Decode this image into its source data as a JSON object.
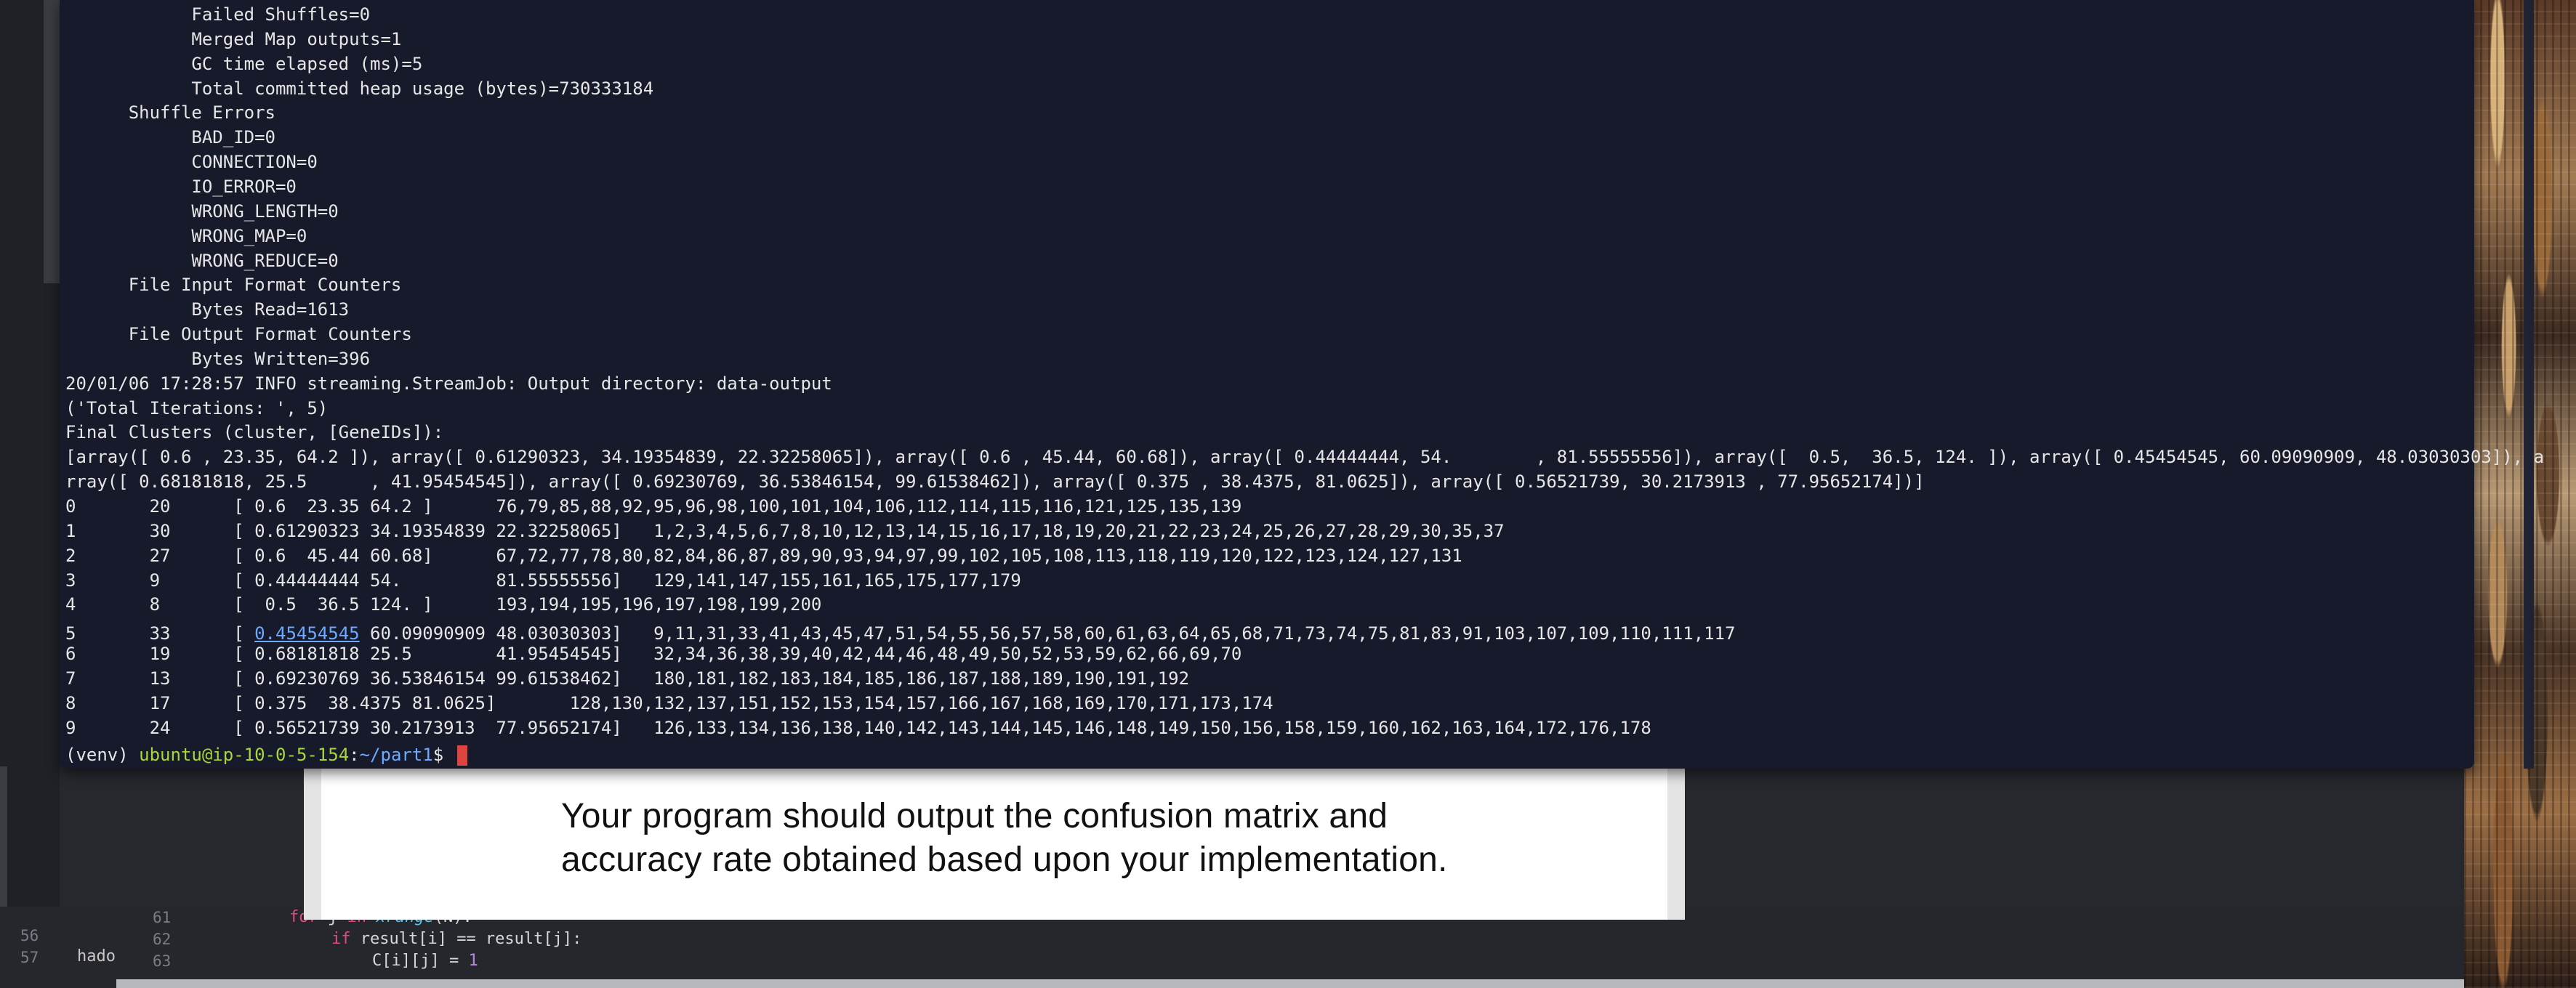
{
  "terminal": {
    "lines": [
      "            Failed Shuffles=0",
      "            Merged Map outputs=1",
      "            GC time elapsed (ms)=5",
      "            Total committed heap usage (bytes)=730333184",
      "      Shuffle Errors",
      "            BAD_ID=0",
      "            CONNECTION=0",
      "            IO_ERROR=0",
      "            WRONG_LENGTH=0",
      "            WRONG_MAP=0",
      "            WRONG_REDUCE=0",
      "      File Input Format Counters",
      "            Bytes Read=1613",
      "      File Output Format Counters",
      "            Bytes Written=396",
      "20/01/06 17:28:57 INFO streaming.StreamJob: Output directory: data-output",
      "('Total Iterations: ', 5)",
      "Final Clusters (cluster, [GeneIDs]):",
      "[array([ 0.6 , 23.35, 64.2 ]), array([ 0.61290323, 34.19354839, 22.32258065]), array([ 0.6 , 45.44, 60.68]), array([ 0.44444444, 54.        , 81.55555556]), array([  0.5,  36.5, 124. ]), array([ 0.45454545, 60.09090909, 48.03030303]), a",
      "rray([ 0.68181818, 25.5      , 41.95454545]), array([ 0.69230769, 36.53846154, 99.61538462]), array([ 0.375 , 38.4375, 81.0625]), array([ 0.56521739, 30.2173913 , 77.95652174])]",
      "0       20      [ 0.6  23.35 64.2 ]      76,79,85,88,92,95,96,98,100,101,104,106,112,114,115,116,121,125,135,139",
      "1       30      [ 0.61290323 34.19354839 22.32258065]   1,2,3,4,5,6,7,8,10,12,13,14,15,16,17,18,19,20,21,22,23,24,25,26,27,28,29,30,35,37",
      "2       27      [ 0.6  45.44 60.68]      67,72,77,78,80,82,84,86,87,89,90,93,94,97,99,102,105,108,113,118,119,120,122,123,124,127,131",
      "3       9       [ 0.44444444 54.         81.55555556]   129,141,147,155,161,165,175,177,179",
      "4       8       [  0.5  36.5 124. ]      193,194,195,196,197,198,199,200"
    ],
    "row5_prefix": "5       33      [ ",
    "row5_link": "0.45454545",
    "row5_suffix": " 60.09090909 48.03030303]   9,11,31,33,41,43,45,47,51,54,55,56,57,58,60,61,63,64,65,68,71,73,74,75,81,83,91,103,107,109,110,111,117",
    "lines_after": [
      "6       19      [ 0.68181818 25.5        41.95454545]   32,34,36,38,39,40,42,44,46,48,49,50,52,53,59,62,66,69,70",
      "7       13      [ 0.69230769 36.53846154 99.61538462]   180,181,182,183,184,185,186,187,188,189,190,191,192",
      "8       17      [ 0.375  38.4375 81.0625]       128,130,132,137,151,152,153,154,157,166,167,168,169,170,171,173,174",
      "9       24      [ 0.56521739 30.2173913  77.95652174]   126,133,134,136,138,140,142,143,144,145,146,148,149,150,156,158,159,160,162,163,164,172,176,178"
    ],
    "prompt_venv": "(venv) ",
    "prompt_user": "ubuntu@ip-10-0-5-154",
    "prompt_sep": ":",
    "prompt_path": "~/part1",
    "prompt_symbol": "$ "
  },
  "document": {
    "line1": "Your program should output the confusion matrix and",
    "line2": "accuracy rate obtained based upon your implementation."
  },
  "editor": {
    "side_word": "hado",
    "gutter": [
      "56",
      "57",
      "61",
      "62",
      "63"
    ],
    "code": {
      "line61_kw": "for",
      "line61_rest": " j ",
      "line61_kw2": "in",
      "line61_fn": "xrange",
      "line61_tail": "(N):",
      "line62_kw": "if",
      "line62_rest": " result[i] == result[j]:",
      "line63_rest": "C[i][j] = ",
      "line63_num": "1"
    }
  }
}
